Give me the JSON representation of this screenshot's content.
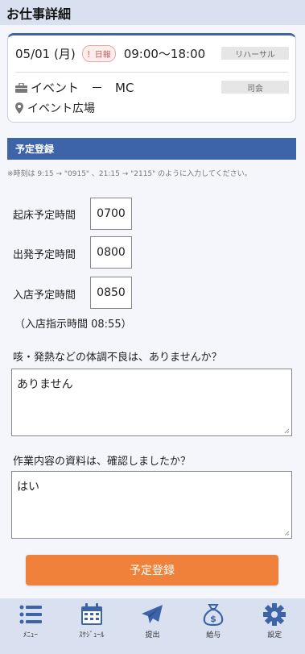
{
  "header": {
    "title": "お仕事詳細"
  },
  "job": {
    "date": "05/01 (月)",
    "report_badge": "！日報",
    "time": "09:00〜18:00",
    "tag1": "リハーサル",
    "category": "イベント　－　MC",
    "tag2": "司会",
    "location": "イベント広場"
  },
  "section": {
    "title": "予定登録"
  },
  "note": "※時刻は 9:15 → \"0915\" 、21:15 → \"2115\" のように入力してください。",
  "fields": [
    {
      "label": "起床予定時間",
      "value": "0700"
    },
    {
      "label": "出発予定時間",
      "value": "0800"
    },
    {
      "label": "入店予定時間",
      "value": "0850"
    }
  ],
  "instruction": "（入店指示時間 08:55）",
  "q1": {
    "label": "咳・発熱などの体調不良は、ありませんか？",
    "value": "ありません"
  },
  "q2": {
    "label": "作業内容の資料は、確認しましたか？",
    "value": "はい"
  },
  "submit_label": "予定登録",
  "nav": {
    "menu": "ﾒﾆｭｰ",
    "schedule": "ｽｹｼﾞｭｰﾙ",
    "submit": "提出",
    "salary": "給与",
    "settings": "設定"
  },
  "colors": {
    "accent": "#3e64a8",
    "button": "#f0813a",
    "nav_bg": "#d9e1f1"
  }
}
